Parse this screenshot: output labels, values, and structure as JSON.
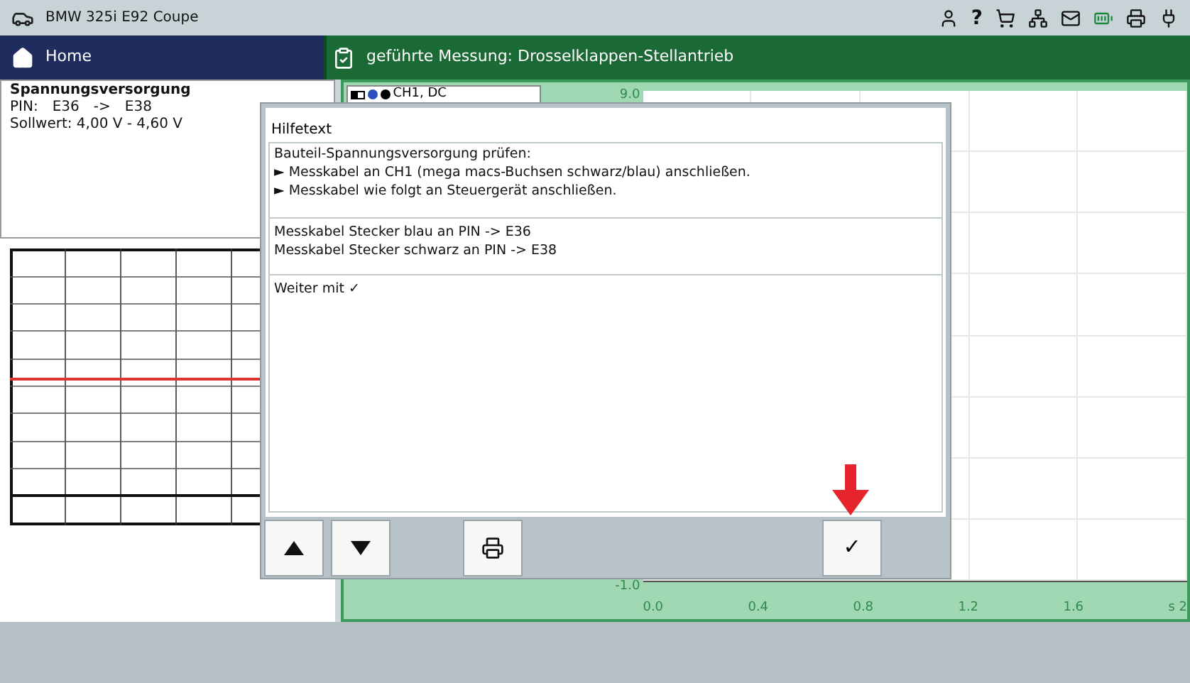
{
  "vehicle": "BMW 325i E92 Coupe",
  "toolbar": {
    "help": "?"
  },
  "nav": {
    "home": "Home",
    "title": "geführte Messung: Drosselklappen-Stellantrieb"
  },
  "info": {
    "title": "Spannungsversorgung",
    "pin": [
      "PIN:",
      "E36",
      "->",
      "E38"
    ],
    "target": "Sollwert: 4,00 V - 4,60 V"
  },
  "chart": {
    "channel": "CH1, DC",
    "y_labels": [
      "9.0",
      "-1.0"
    ],
    "x_labels": [
      "0.0",
      "0.4",
      "0.8",
      "1.2",
      "1.6",
      "s 2"
    ]
  },
  "dialog": {
    "title": "Hilfetext",
    "sections": [
      [
        "Bauteil-Spannungsversorgung prüfen:",
        "► Messkabel an CH1 (mega macs-Buchsen schwarz/blau) anschließen.",
        "► Messkabel wie folgt an Steuergerät anschließen."
      ],
      [
        "Messkabel Stecker blau an PIN -> E36",
        "Messkabel Stecker schwarz an PIN -> E38"
      ],
      [
        "Weiter mit ✓"
      ]
    ],
    "buttons": [
      {
        "kind": "up"
      },
      {
        "kind": "down"
      },
      {
        "kind": "print"
      },
      {
        "kind": "confirm",
        "label": "✓"
      }
    ]
  }
}
